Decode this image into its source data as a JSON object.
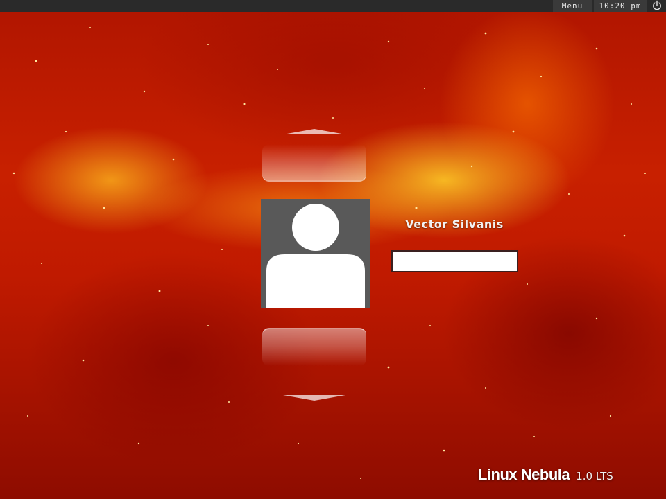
{
  "topbar": {
    "menu_label": "Menu",
    "clock": "10:20 pm",
    "power_icon": "power-icon"
  },
  "login": {
    "username": "Vector Silvanis",
    "password_value": "",
    "avatar_icon": "user-silhouette-icon",
    "prev_icon": "chevron-up-icon",
    "next_icon": "chevron-down-icon"
  },
  "branding": {
    "name": "Linux Nebula",
    "version": "1.0 LTS"
  },
  "colors": {
    "topbar": "#2a2a2a",
    "avatar_bg": "#595959",
    "background": "#c01a00",
    "accent_yellow": "#ffd028"
  }
}
